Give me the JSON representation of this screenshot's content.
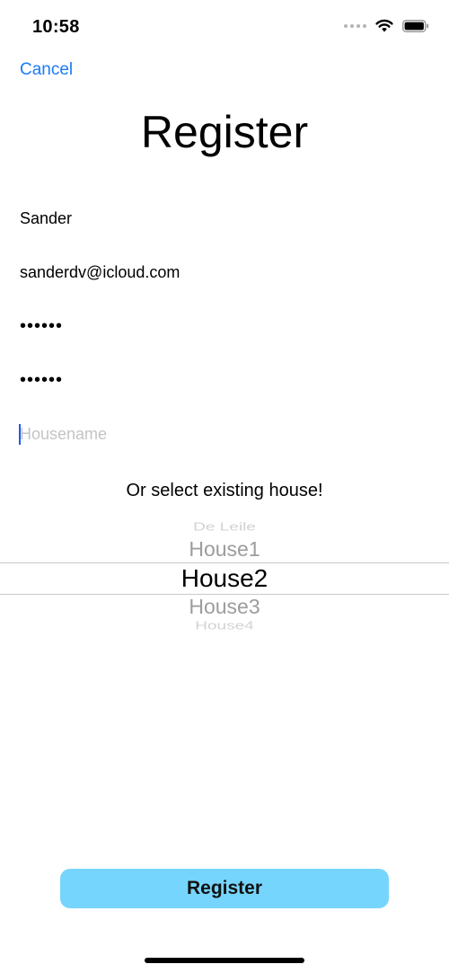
{
  "status_bar": {
    "time": "10:58",
    "icons": [
      "signal-dots-icon",
      "wifi-icon",
      "battery-icon"
    ]
  },
  "nav": {
    "cancel_label": "Cancel"
  },
  "title": "Register",
  "form": {
    "name_value": "Sander",
    "email_value": "sanderdv@icloud.com",
    "password_value": "••••••",
    "confirm_password_value": "••••••",
    "housename_value": "",
    "housename_placeholder": "Housename"
  },
  "select_label": "Or select existing house!",
  "house_picker": {
    "items": [
      "De Leile",
      "House1",
      "House2",
      "House3",
      "House4"
    ],
    "selected": "House2"
  },
  "register_label": "Register",
  "colors": {
    "accent": "#1a7af8",
    "button_bg": "#76d5fd"
  }
}
